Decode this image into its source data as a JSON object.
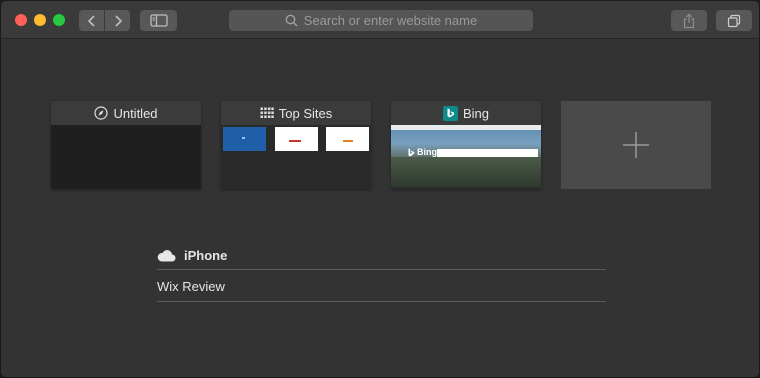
{
  "toolbar": {
    "address_placeholder": "Search or enter website name",
    "icons": {
      "back": "chevron-left-icon",
      "forward": "chevron-right-icon",
      "sidebar": "sidebar-icon",
      "search": "search-icon",
      "share": "share-icon",
      "tabs": "tab-overview-icon"
    }
  },
  "favorites": [
    {
      "label": "Untitled",
      "icon": "compass-icon"
    },
    {
      "label": "Top Sites",
      "icon": "grid-icon"
    },
    {
      "label": "Bing",
      "icon": "bing-icon"
    },
    {
      "label": "",
      "icon": "plus-icon"
    }
  ],
  "bing_thumbnail_logo": "Bing",
  "icloud": {
    "device": "iPhone",
    "icon": "cloud-icon",
    "tabs": [
      "Wix Review"
    ]
  },
  "colors": {
    "close": "#ff5f57",
    "minimize": "#febc2e",
    "maximize": "#28c840",
    "bing_brand": "#0f8a8a"
  }
}
